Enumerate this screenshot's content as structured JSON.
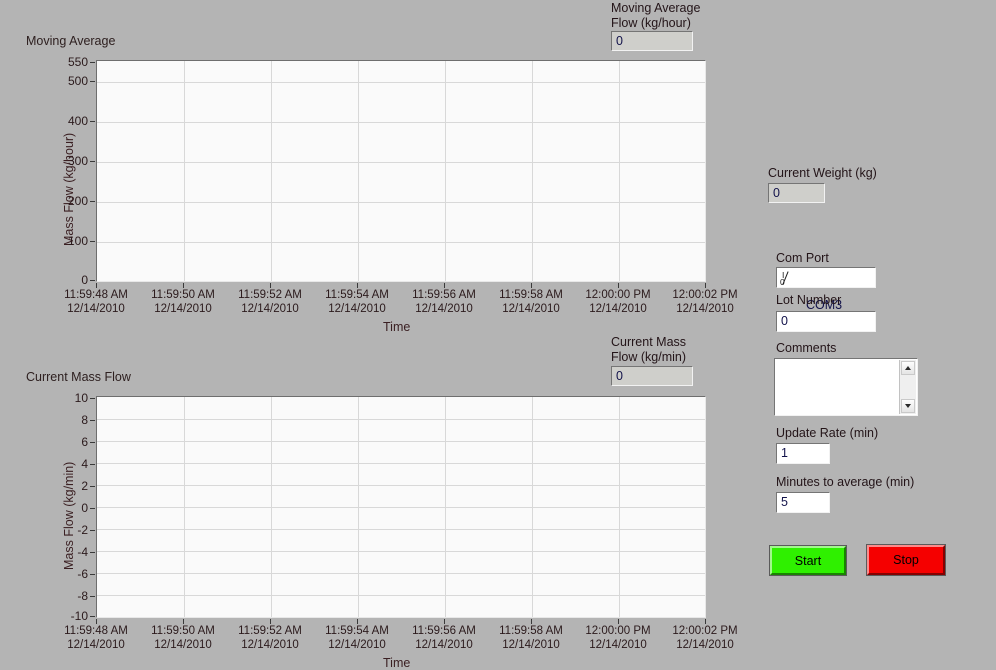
{
  "window": {
    "background_color": "#b4b4b4"
  },
  "indicators": {
    "moving_average_flow": {
      "label_line1": "Moving Average",
      "label_line2": "Flow (kg/hour)",
      "value": "0"
    },
    "current_mass_flow": {
      "label_line1": "Current Mass",
      "label_line2": "Flow (kg/min)",
      "value": "0"
    },
    "current_weight": {
      "label": "Current Weight (kg)",
      "value": "0"
    }
  },
  "controls": {
    "com_port": {
      "label": "Com Port",
      "value": "COM3",
      "icon": "io-refnum-icon"
    },
    "lot_number": {
      "label": "Lot Number",
      "value": "0"
    },
    "comments": {
      "label": "Comments",
      "value": ""
    },
    "update_rate": {
      "label": "Update Rate (min)",
      "value": "1"
    },
    "minutes_to_average": {
      "label": "Minutes to average (min)",
      "value": "5"
    }
  },
  "buttons": {
    "start": {
      "label": "Start",
      "color": "#2ff000"
    },
    "stop": {
      "label": "Stop",
      "color": "#f50000"
    }
  },
  "chart_data": [
    {
      "type": "line",
      "name": "moving-average-chart",
      "title": "Moving Average",
      "ylabel": "Mass Flow (kg/hour)",
      "xlabel": "Time",
      "ylim": [
        0,
        550
      ],
      "yticks": [
        550,
        500,
        400,
        300,
        200,
        100,
        0
      ],
      "ytick_labels": [
        "550",
        "500",
        "400",
        "300",
        "200",
        "100",
        "0"
      ],
      "xtick_labels": [
        "11:59:48 AM\n12/14/2010",
        "11:59:50 AM\n12/14/2010",
        "11:59:52 AM\n12/14/2010",
        "11:59:54 AM\n12/14/2010",
        "11:59:56 AM\n12/14/2010",
        "11:59:58 AM\n12/14/2010",
        "12:00:00 PM\n12/14/2010",
        "12:00:02 PM\n12/14/2010"
      ],
      "series": [
        {
          "name": "Moving Average",
          "values": []
        }
      ],
      "grid": true,
      "legend": "none",
      "plot_background": "#fafafa",
      "grid_color": "#d8d8d8"
    },
    {
      "type": "line",
      "name": "current-mass-flow-chart",
      "title": "Current Mass Flow",
      "ylabel": "Mass Flow (kg/min)",
      "xlabel": "Time",
      "ylim": [
        -10,
        10
      ],
      "yticks": [
        10,
        8,
        6,
        4,
        2,
        0,
        -2,
        -4,
        -6,
        -8,
        -10
      ],
      "ytick_labels": [
        "10",
        "8",
        "6",
        "4",
        "2",
        "0",
        "-2",
        "-4",
        "-6",
        "-8",
        "-10"
      ],
      "xtick_labels": [
        "11:59:48 AM\n12/14/2010",
        "11:59:50 AM\n12/14/2010",
        "11:59:52 AM\n12/14/2010",
        "11:59:54 AM\n12/14/2010",
        "11:59:56 AM\n12/14/2010",
        "11:59:58 AM\n12/14/2010",
        "12:00:00 PM\n12/14/2010",
        "12:00:02 PM\n12/14/2010"
      ],
      "series": [
        {
          "name": "Current Mass Flow",
          "values": []
        }
      ],
      "grid": true,
      "legend": "none",
      "plot_background": "#fafafa",
      "grid_color": "#d8d8d8"
    }
  ]
}
